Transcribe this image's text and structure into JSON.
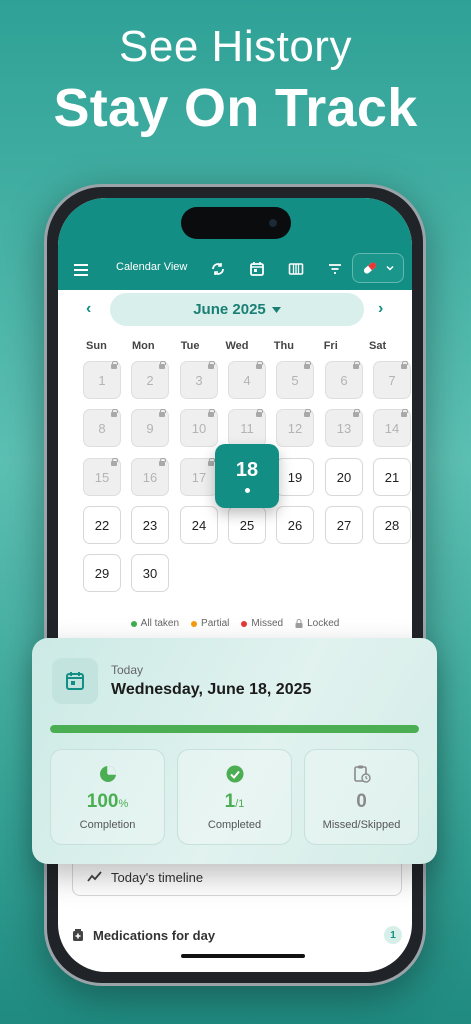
{
  "hero": {
    "line1": "See History",
    "line2": "Stay On Track"
  },
  "appbar": {
    "title": "Calendar View"
  },
  "calendar": {
    "month_label": "June 2025",
    "weekdays": [
      "Sun",
      "Mon",
      "Tue",
      "Wed",
      "Thu",
      "Fri",
      "Sat"
    ],
    "selected_day": "18",
    "days": [
      {
        "n": "1",
        "locked": true
      },
      {
        "n": "2",
        "locked": true
      },
      {
        "n": "3",
        "locked": true
      },
      {
        "n": "4",
        "locked": true
      },
      {
        "n": "5",
        "locked": true
      },
      {
        "n": "6",
        "locked": true
      },
      {
        "n": "7",
        "locked": true
      },
      {
        "n": "8",
        "locked": true
      },
      {
        "n": "9",
        "locked": true
      },
      {
        "n": "10",
        "locked": true
      },
      {
        "n": "11",
        "locked": true
      },
      {
        "n": "12",
        "locked": true
      },
      {
        "n": "13",
        "locked": true
      },
      {
        "n": "14",
        "locked": true
      },
      {
        "n": "15",
        "locked": true
      },
      {
        "n": "16",
        "locked": true
      },
      {
        "n": "17",
        "locked": true
      },
      {
        "n": "18",
        "locked": false
      },
      {
        "n": "19",
        "locked": false
      },
      {
        "n": "20",
        "locked": false
      },
      {
        "n": "21",
        "locked": false
      },
      {
        "n": "22",
        "locked": false
      },
      {
        "n": "23",
        "locked": false
      },
      {
        "n": "24",
        "locked": false
      },
      {
        "n": "25",
        "locked": false
      },
      {
        "n": "26",
        "locked": false
      },
      {
        "n": "27",
        "locked": false
      },
      {
        "n": "28",
        "locked": false
      },
      {
        "n": "29",
        "locked": false
      },
      {
        "n": "30",
        "locked": false
      }
    ]
  },
  "legend": {
    "all_taken": "All taken",
    "partial": "Partial",
    "missed": "Missed",
    "locked": "Locked",
    "colors": {
      "all_taken": "#3fae4a",
      "partial": "#f39c12",
      "missed": "#e53935",
      "locked": "#9e9e9e"
    }
  },
  "summary": {
    "today_label": "Today",
    "date": "Wednesday, June 18, 2025",
    "progress_fraction": 1.0,
    "stats": [
      {
        "icon": "pie-chart-icon",
        "value": "100",
        "suffix": "%",
        "label": "Completion",
        "color": "#4cae52"
      },
      {
        "icon": "check-circle-icon",
        "value": "1",
        "suffix": "/1",
        "label": "Completed",
        "color": "#4cae52"
      },
      {
        "icon": "clipboard-clock-icon",
        "value": "0",
        "suffix": "",
        "label": "Missed/Skipped",
        "color": "#8a8a8a"
      }
    ]
  },
  "timeline": {
    "label": "Today's timeline"
  },
  "meds": {
    "label": "Medications for day",
    "count": "1"
  },
  "colors": {
    "primary": "#138e84",
    "accent_light": "#d8efec"
  }
}
